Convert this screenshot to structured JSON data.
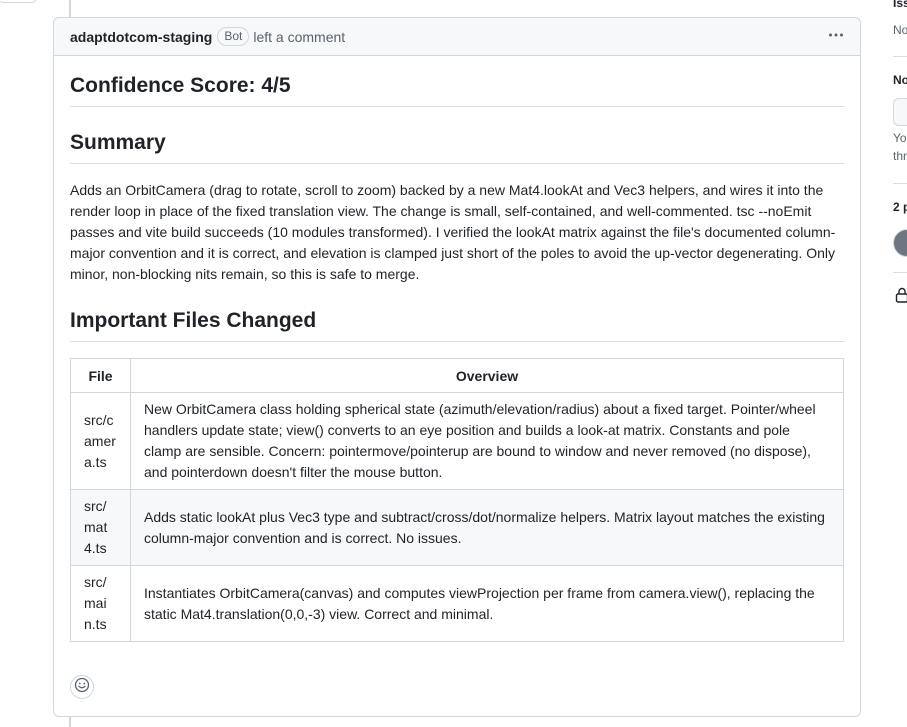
{
  "comment": {
    "author": "adaptdotcom-staging",
    "badge": "Bot",
    "action": "left a comment",
    "menu_icon": "kebab-horizontal-icon",
    "confidence_heading": "Confidence Score: 4/5",
    "summary_heading": "Summary",
    "summary_text": "Adds an OrbitCamera (drag to rotate, scroll to zoom) backed by a new Mat4.lookAt and Vec3 helpers, and wires it into the render loop in place of the fixed translation view. The change is small, self-contained, and well-commented. tsc --noEmit passes and vite build succeeds (10 modules transformed). I verified the lookAt matrix against the file's documented column-major convention and it is correct, and elevation is clamped just short of the poles to avoid the up-vector degenerating. Only minor, non-blocking nits remain, so this is safe to merge.",
    "files_heading": "Important Files Changed",
    "table": {
      "headers": [
        "File",
        "Overview"
      ],
      "rows": [
        {
          "file": "src/camera.ts",
          "overview": "New OrbitCamera class holding spherical state (azimuth/elevation/radius) about a fixed target. Pointer/wheel handlers update state; view() converts to an eye position and builds a look-at matrix. Constants and pole clamp are sensible. Concern: pointermove/pointerup are bound to window and never removed (no dispose), and pointerdown doesn't filter the mouse button."
        },
        {
          "file": "src/mat4.ts",
          "overview": "Adds static lookAt plus Vec3 type and subtract/cross/dot/normalize helpers. Matrix layout matches the existing column-major convention and is correct. No issues."
        },
        {
          "file": "src/main.ts",
          "overview": "Instantiates OrbitCamera(canvas) and computes viewProjection per frame from camera.view(), replacing the static Mat4.translation(0,0,-3) view. Correct and minimal."
        }
      ]
    },
    "reaction_icon": "smiley-icon"
  },
  "sidebar": {
    "texts": [
      "Iss",
      "No",
      "No",
      "Yo",
      "thr",
      "2 p"
    ],
    "lock_icon": "lock-icon"
  }
}
